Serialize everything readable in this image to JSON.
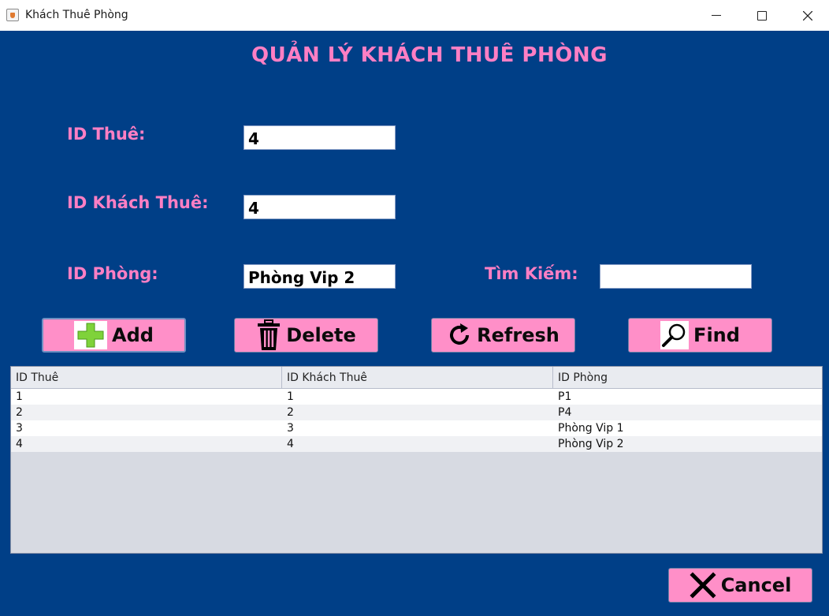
{
  "window": {
    "title": "Khách Thuê Phòng"
  },
  "form": {
    "heading": "QUẢN LÝ KHÁCH THUÊ PHÒNG",
    "id_thue_label": "ID Thuê:",
    "id_thue_value": "4",
    "id_khach_thue_label": "ID Khách Thuê:",
    "id_khach_thue_value": "4",
    "id_phong_label": "ID Phòng:",
    "id_phong_value": "Phòng Vip 2",
    "search_label": "Tìm Kiếm:",
    "search_value": ""
  },
  "buttons": {
    "add": "Add",
    "delete": "Delete",
    "refresh": "Refresh",
    "find": "Find",
    "cancel": "Cancel"
  },
  "table": {
    "columns": [
      "ID Thuê",
      "ID Khách Thuê",
      "ID Phòng"
    ],
    "rows": [
      [
        "1",
        "1",
        "P1"
      ],
      [
        "2",
        "2",
        "P4"
      ],
      [
        "3",
        "3",
        "Phòng Vip 1"
      ],
      [
        "4",
        "4",
        "Phòng Vip 2"
      ]
    ]
  },
  "colors": {
    "background": "#003f87",
    "label": "#ff7fc4",
    "button": "#ff8fc8"
  },
  "icons": {
    "add": "plus-icon",
    "delete": "trash-icon",
    "refresh": "refresh-icon",
    "find": "magnifier-icon",
    "cancel": "x-icon"
  }
}
